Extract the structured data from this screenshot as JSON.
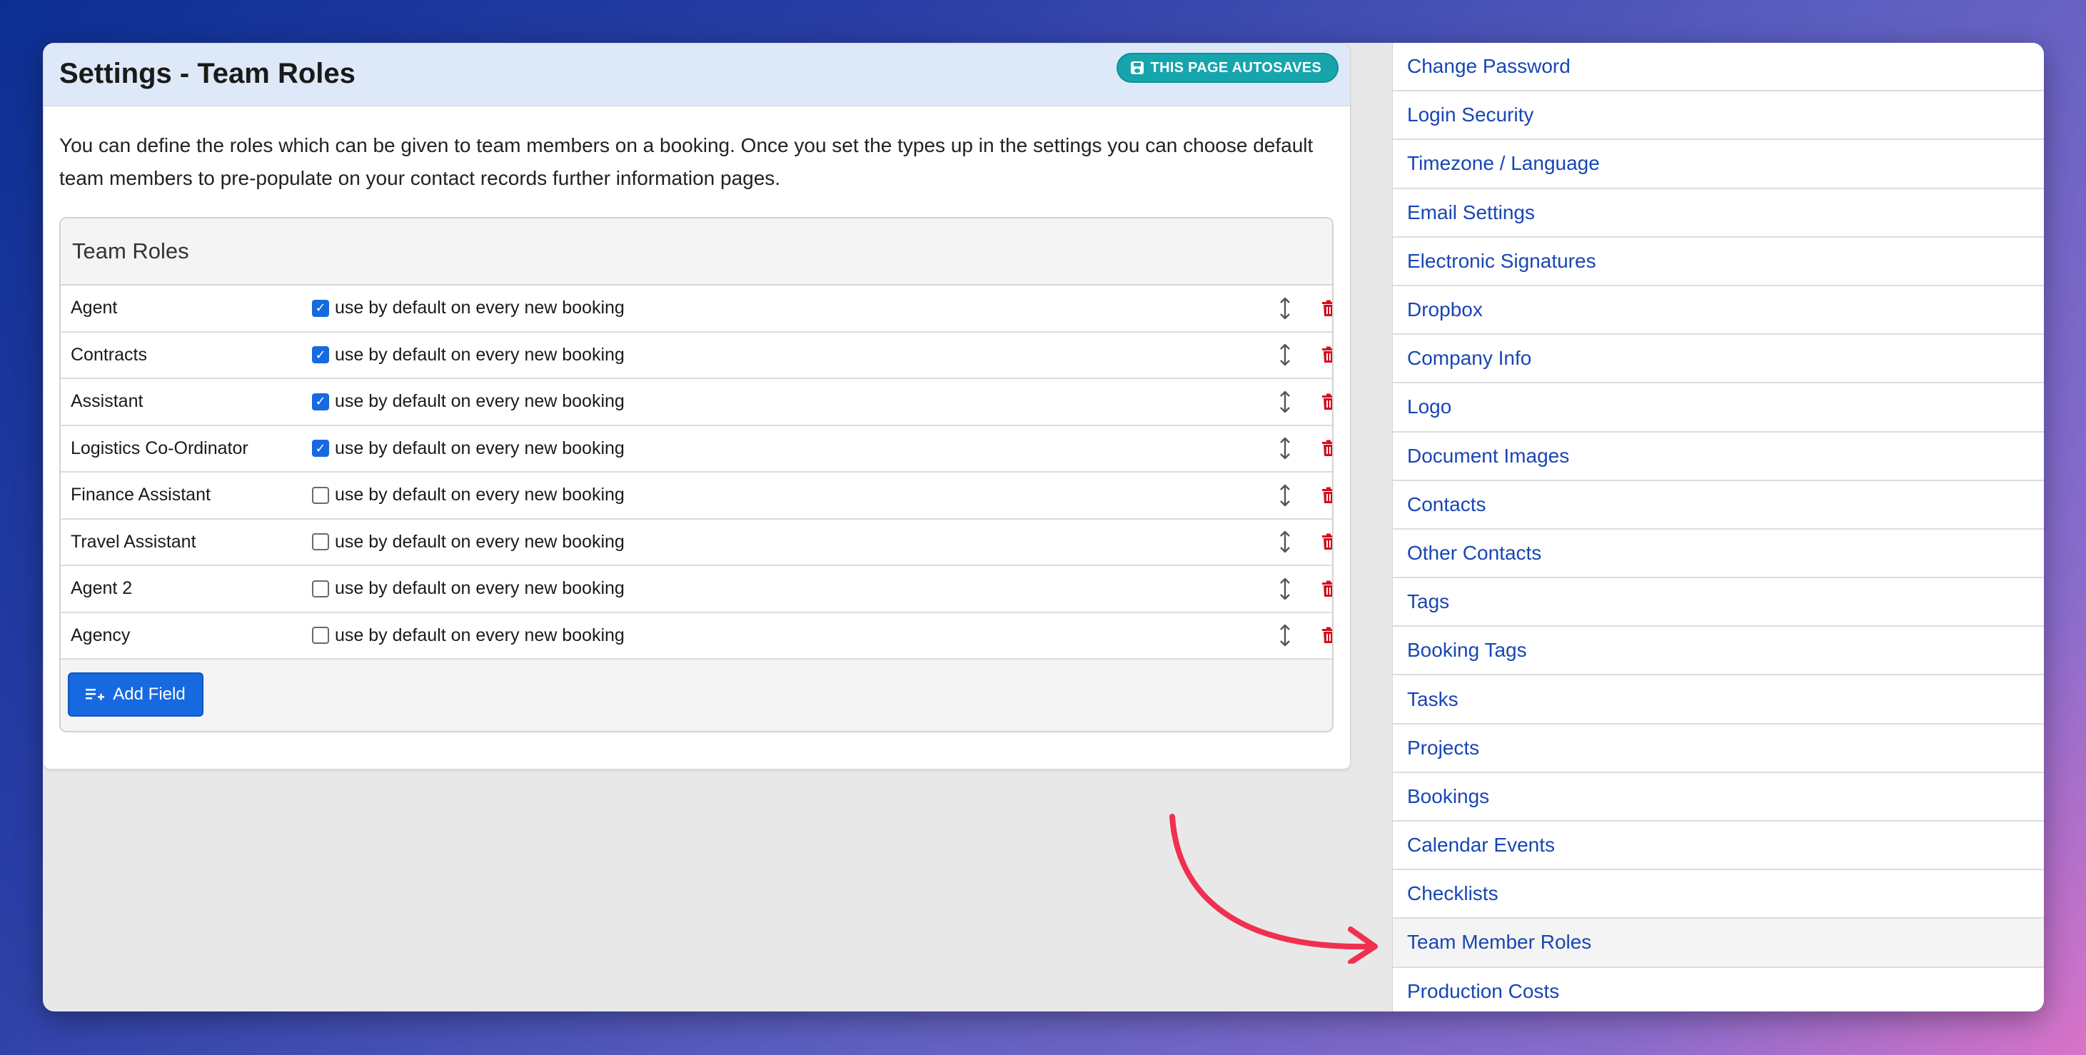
{
  "page": {
    "title": "Settings - Team Roles",
    "autosave_badge": "THIS PAGE AUTOSAVES",
    "description": "You can define the roles which can be given to team members on a booking. Once you set the types up in the settings you can choose default team members to pre-populate on your contact records further information pages."
  },
  "roles_card": {
    "title": "Team Roles",
    "default_label": "use by default on every new booking",
    "add_button_label": "Add Field",
    "rows": [
      {
        "name": "Agent",
        "checked": true
      },
      {
        "name": "Contracts",
        "checked": true
      },
      {
        "name": "Assistant",
        "checked": true
      },
      {
        "name": "Logistics Co-Ordinator",
        "checked": true
      },
      {
        "name": "Finance Assistant",
        "checked": false
      },
      {
        "name": "Travel Assistant",
        "checked": false
      },
      {
        "name": "Agent 2",
        "checked": false
      },
      {
        "name": "Agency",
        "checked": false
      }
    ]
  },
  "sidebar": {
    "active_index": 18,
    "items": [
      "Change Password",
      "Login Security",
      "Timezone / Language",
      "Email Settings",
      "Electronic Signatures",
      "Dropbox",
      "Company Info",
      "Logo",
      "Document Images",
      "Contacts",
      "Other Contacts",
      "Tags",
      "Booking Tags",
      "Tasks",
      "Projects",
      "Bookings",
      "Calendar Events",
      "Checklists",
      "Team Member Roles",
      "Production Costs"
    ]
  },
  "colors": {
    "accent": "#1769e0",
    "badge": "#16a5ad",
    "delete": "#d40f1e",
    "link": "#1846b4",
    "annotation_arrow": "#f0304f"
  },
  "icons": {
    "badge": "floppy-disk-icon",
    "sort": "vertical-arrows-icon",
    "delete": "trash-icon",
    "add": "playlist-add-icon"
  }
}
